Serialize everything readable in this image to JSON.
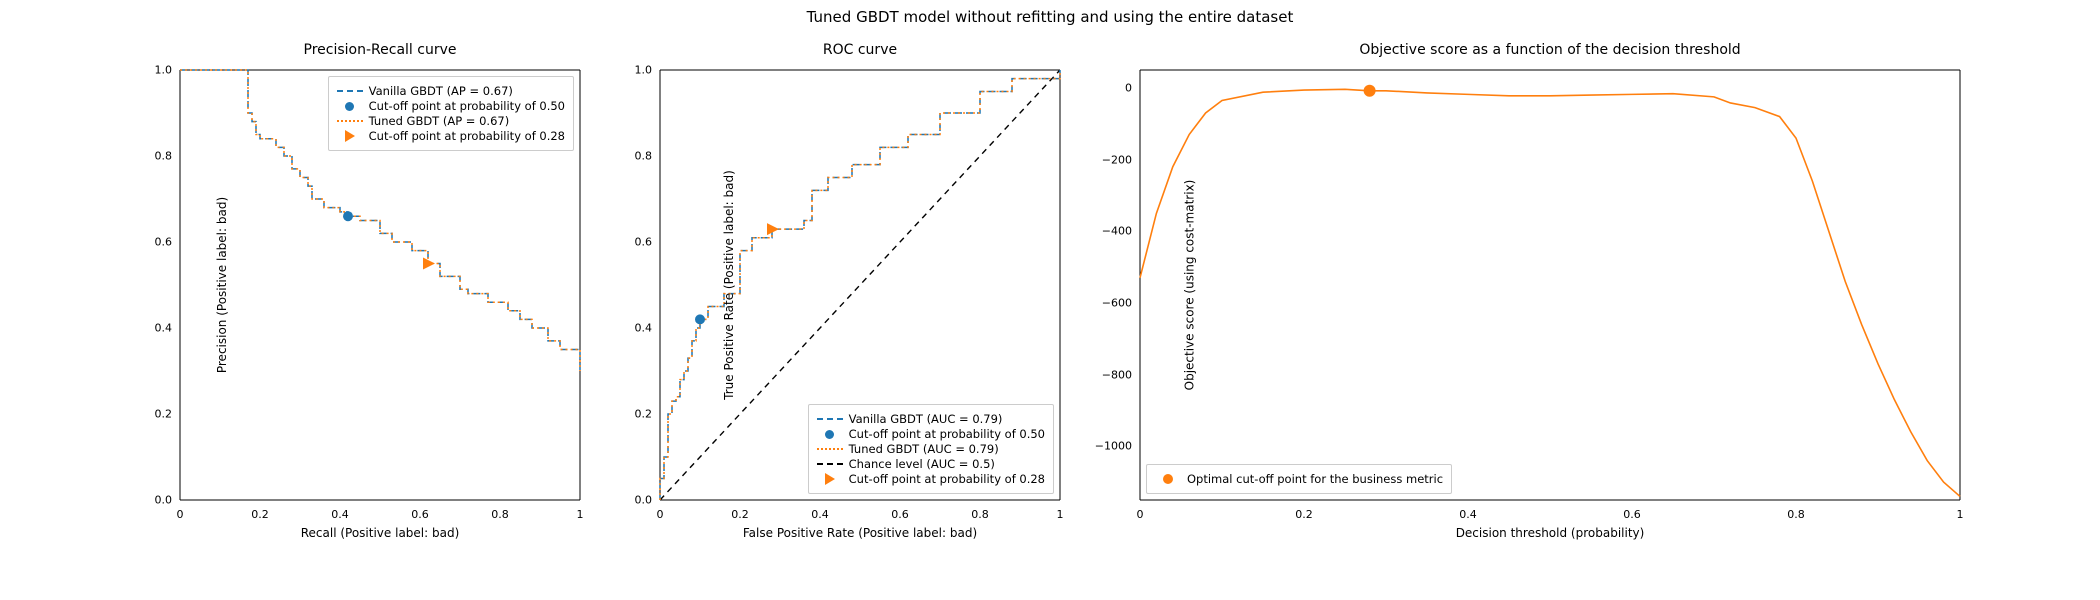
{
  "suptitle": "Tuned GBDT model without refitting and using the entire dataset",
  "chart_data": [
    {
      "type": "line",
      "title": "Precision-Recall curve",
      "xlabel": "Recall (Positive label: bad)",
      "ylabel": "Precision (Positive label: bad)",
      "xlim": [
        0.0,
        1.0
      ],
      "ylim": [
        0.0,
        1.0
      ],
      "xticks": [
        0.0,
        0.2,
        0.4,
        0.6,
        0.8,
        1.0
      ],
      "yticks": [
        0.0,
        0.2,
        0.4,
        0.6,
        0.8,
        1.0
      ],
      "series": [
        {
          "name": "Vanilla GBDT (AP = 0.67)",
          "x": [
            0.0,
            0.02,
            0.04,
            0.07,
            0.09,
            0.12,
            0.14,
            0.17,
            0.17,
            0.18,
            0.19,
            0.2,
            0.21,
            0.24,
            0.26,
            0.28,
            0.3,
            0.32,
            0.33,
            0.36,
            0.4,
            0.42,
            0.45,
            0.5,
            0.53,
            0.58,
            0.62,
            0.65,
            0.7,
            0.72,
            0.77,
            0.82,
            0.85,
            0.88,
            0.92,
            0.95,
            1.0
          ],
          "y": [
            1.0,
            1.0,
            1.0,
            1.0,
            1.0,
            1.0,
            1.0,
            0.95,
            0.9,
            0.88,
            0.85,
            0.84,
            0.84,
            0.82,
            0.8,
            0.77,
            0.75,
            0.73,
            0.7,
            0.68,
            0.67,
            0.66,
            0.65,
            0.62,
            0.6,
            0.58,
            0.55,
            0.52,
            0.49,
            0.48,
            0.46,
            0.44,
            0.42,
            0.4,
            0.37,
            0.35,
            0.3
          ]
        },
        {
          "name": "Tuned GBDT (AP = 0.67)",
          "x": [
            0.0,
            0.02,
            0.04,
            0.07,
            0.09,
            0.12,
            0.14,
            0.17,
            0.17,
            0.18,
            0.19,
            0.2,
            0.21,
            0.24,
            0.26,
            0.28,
            0.3,
            0.32,
            0.33,
            0.36,
            0.4,
            0.42,
            0.45,
            0.5,
            0.53,
            0.58,
            0.62,
            0.65,
            0.7,
            0.72,
            0.77,
            0.82,
            0.85,
            0.88,
            0.92,
            0.95,
            1.0
          ],
          "y": [
            1.0,
            1.0,
            1.0,
            1.0,
            1.0,
            1.0,
            1.0,
            0.95,
            0.9,
            0.88,
            0.85,
            0.84,
            0.84,
            0.82,
            0.8,
            0.77,
            0.75,
            0.73,
            0.7,
            0.68,
            0.67,
            0.66,
            0.65,
            0.62,
            0.6,
            0.58,
            0.55,
            0.52,
            0.49,
            0.48,
            0.46,
            0.44,
            0.42,
            0.4,
            0.37,
            0.35,
            0.3
          ]
        }
      ],
      "points": [
        {
          "name": "Cut-off point at probability of 0.50",
          "shape": "circle",
          "color": "#1f77b4",
          "x": 0.42,
          "y": 0.66
        },
        {
          "name": "Cut-off point at probability of 0.28",
          "shape": "triangle",
          "color": "#ff7f0e",
          "x": 0.62,
          "y": 0.55
        }
      ],
      "legend": [
        "Vanilla GBDT (AP = 0.67)",
        "Cut-off point at probability of 0.50",
        "Tuned GBDT (AP = 0.67)",
        "Cut-off point at probability of 0.28"
      ]
    },
    {
      "type": "line",
      "title": "ROC curve",
      "xlabel": "False Positive Rate (Positive label: bad)",
      "ylabel": "True Positive Rate (Positive label: bad)",
      "xlim": [
        0.0,
        1.0
      ],
      "ylim": [
        0.0,
        1.0
      ],
      "xticks": [
        0.0,
        0.2,
        0.4,
        0.6,
        0.8,
        1.0
      ],
      "yticks": [
        0.0,
        0.2,
        0.4,
        0.6,
        0.8,
        1.0
      ],
      "series": [
        {
          "name": "Vanilla GBDT (AUC = 0.79)",
          "x": [
            0.0,
            0.0,
            0.01,
            0.02,
            0.02,
            0.03,
            0.04,
            0.05,
            0.06,
            0.07,
            0.08,
            0.09,
            0.1,
            0.1,
            0.12,
            0.16,
            0.2,
            0.2,
            0.23,
            0.28,
            0.3,
            0.36,
            0.38,
            0.42,
            0.48,
            0.55,
            0.62,
            0.7,
            0.8,
            0.88,
            1.0
          ],
          "y": [
            0.0,
            0.05,
            0.1,
            0.15,
            0.2,
            0.23,
            0.24,
            0.28,
            0.3,
            0.33,
            0.37,
            0.4,
            0.42,
            0.42,
            0.45,
            0.48,
            0.5,
            0.58,
            0.61,
            0.63,
            0.63,
            0.65,
            0.72,
            0.75,
            0.78,
            0.82,
            0.85,
            0.9,
            0.95,
            0.98,
            1.0
          ]
        },
        {
          "name": "Tuned GBDT (AUC = 0.79)",
          "x": [
            0.0,
            0.0,
            0.01,
            0.02,
            0.02,
            0.03,
            0.04,
            0.05,
            0.06,
            0.07,
            0.08,
            0.09,
            0.1,
            0.1,
            0.12,
            0.16,
            0.2,
            0.2,
            0.23,
            0.28,
            0.3,
            0.36,
            0.38,
            0.42,
            0.48,
            0.55,
            0.62,
            0.7,
            0.8,
            0.88,
            1.0
          ],
          "y": [
            0.0,
            0.05,
            0.1,
            0.15,
            0.2,
            0.23,
            0.24,
            0.28,
            0.3,
            0.33,
            0.37,
            0.4,
            0.42,
            0.42,
            0.45,
            0.48,
            0.5,
            0.58,
            0.61,
            0.63,
            0.63,
            0.65,
            0.72,
            0.75,
            0.78,
            0.82,
            0.85,
            0.9,
            0.95,
            0.98,
            1.0
          ]
        }
      ],
      "reference": {
        "name": "Chance level (AUC = 0.5)",
        "x": [
          0,
          1
        ],
        "y": [
          0,
          1
        ]
      },
      "points": [
        {
          "name": "Cut-off point at probability of 0.50",
          "shape": "circle",
          "color": "#1f77b4",
          "x": 0.1,
          "y": 0.42
        },
        {
          "name": "Cut-off point at probability of 0.28",
          "shape": "triangle",
          "color": "#ff7f0e",
          "x": 0.28,
          "y": 0.63
        }
      ],
      "legend": [
        "Vanilla GBDT (AUC = 0.79)",
        "Cut-off point at probability of 0.50",
        "Tuned GBDT (AUC = 0.79)",
        "Chance level (AUC = 0.5)",
        "Cut-off point at probability of 0.28"
      ]
    },
    {
      "type": "line",
      "title": "Objective score as a function of the decision threshold",
      "xlabel": "Decision threshold (probability)",
      "ylabel": "Objective score (using cost-matrix)",
      "xlim": [
        0.0,
        1.0
      ],
      "ylim": [
        -1150,
        50
      ],
      "xticks": [
        0.0,
        0.2,
        0.4,
        0.6,
        0.8,
        1.0
      ],
      "yticks": [
        -1000,
        -800,
        -600,
        -400,
        -200,
        0
      ],
      "series": [
        {
          "name": "Objective score",
          "x": [
            0.0,
            0.02,
            0.04,
            0.06,
            0.08,
            0.1,
            0.15,
            0.2,
            0.25,
            0.28,
            0.3,
            0.35,
            0.4,
            0.45,
            0.5,
            0.55,
            0.6,
            0.65,
            0.7,
            0.72,
            0.75,
            0.78,
            0.8,
            0.82,
            0.84,
            0.86,
            0.88,
            0.9,
            0.92,
            0.94,
            0.96,
            0.98,
            1.0
          ],
          "y": [
            -530,
            -350,
            -220,
            -130,
            -70,
            -35,
            -12,
            -6,
            -4,
            -8,
            -8,
            -14,
            -18,
            -22,
            -22,
            -20,
            -18,
            -16,
            -25,
            -42,
            -55,
            -80,
            -140,
            -260,
            -400,
            -540,
            -660,
            -770,
            -870,
            -960,
            -1040,
            -1100,
            -1140
          ]
        }
      ],
      "points": [
        {
          "name": "Optimal cut-off point for the business metric",
          "shape": "circle",
          "color": "#ff7f0e",
          "x": 0.28,
          "y": -8
        }
      ],
      "legend": [
        "Optimal cut-off point for the business metric"
      ]
    }
  ]
}
